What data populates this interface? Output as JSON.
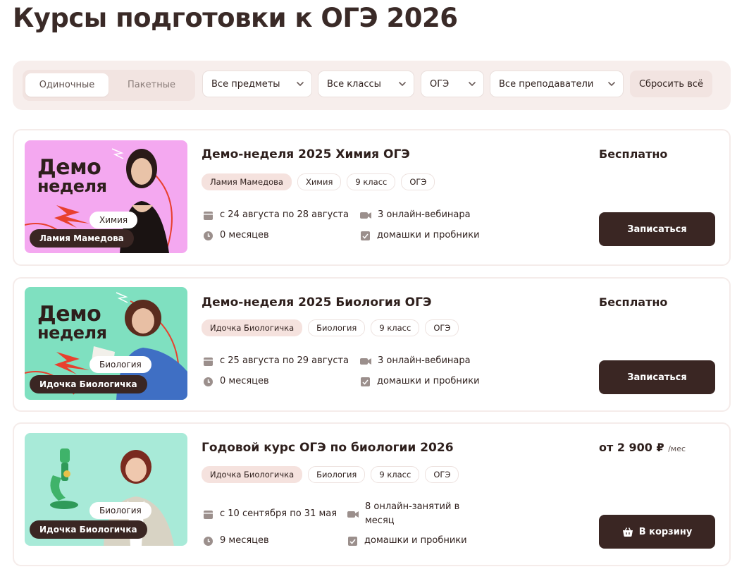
{
  "page": {
    "title": "Курсы подготовки к ОГЭ 2026"
  },
  "filters": {
    "segment": {
      "single": "Одиночные",
      "bundle": "Пакетные",
      "active": "single"
    },
    "subject": "Все предметы",
    "grade": "Все классы",
    "exam": "ОГЭ",
    "teacher": "Все преподаватели",
    "reset": "Сбросить всё"
  },
  "courses": [
    {
      "title": "Демо-неделя 2025 Химия ОГЭ",
      "thumb": {
        "demo_line1": "Демо",
        "demo_line2": "неделя",
        "subject": "Химия",
        "teacher": "Ламия Мамедова",
        "bg": "#f4a8f0"
      },
      "tags": [
        "Ламия Мамедова",
        "Химия",
        "9 класс",
        "ОГЭ"
      ],
      "dates": "с 24 августа по 28 августа",
      "duration": "0 месяцев",
      "lessons": "3 онлайн-вебинара",
      "homework": "домашки и пробники",
      "price": "Бесплатно",
      "price_unit": "",
      "button": "Записаться"
    },
    {
      "title": "Демо-неделя 2025 Биология ОГЭ",
      "thumb": {
        "demo_line1": "Демо",
        "demo_line2": "неделя",
        "subject": "Биология",
        "teacher": "Идочка Биологичка",
        "bg": "#7fe0c0"
      },
      "tags": [
        "Идочка Биологичка",
        "Биология",
        "9 класс",
        "ОГЭ"
      ],
      "dates": "с 25 августа по 29 августа",
      "duration": "0 месяцев",
      "lessons": "3 онлайн-вебинара",
      "homework": "домашки и пробники",
      "price": "Бесплатно",
      "price_unit": "",
      "button": "Записаться"
    },
    {
      "title": "Годовой курс ОГЭ по биологии 2026",
      "thumb": {
        "subject": "Биология",
        "teacher": "Идочка Биологичка",
        "bg": "#a8ead8"
      },
      "tags": [
        "Идочка Биологичка",
        "Биология",
        "9 класс",
        "ОГЭ"
      ],
      "dates": "с 10 сентября по 31 мая",
      "duration": "9 месяцев",
      "lessons": "8 онлайн-занятий в месяц",
      "homework": "домашки и пробники",
      "price": "от 2 900 ₽",
      "price_unit": "/мес",
      "button": "В корзину"
    }
  ],
  "colors": {
    "brand_dark": "#3a2623",
    "filter_bg": "#f7eeec",
    "teacher_tag_bg": "#f5e2de",
    "accent_red": "#e8402e"
  },
  "icons": [
    "chevron-down-icon",
    "calendar-icon",
    "clock-icon",
    "video-icon",
    "homework-icon",
    "basket-icon",
    "lightning-icon"
  ]
}
